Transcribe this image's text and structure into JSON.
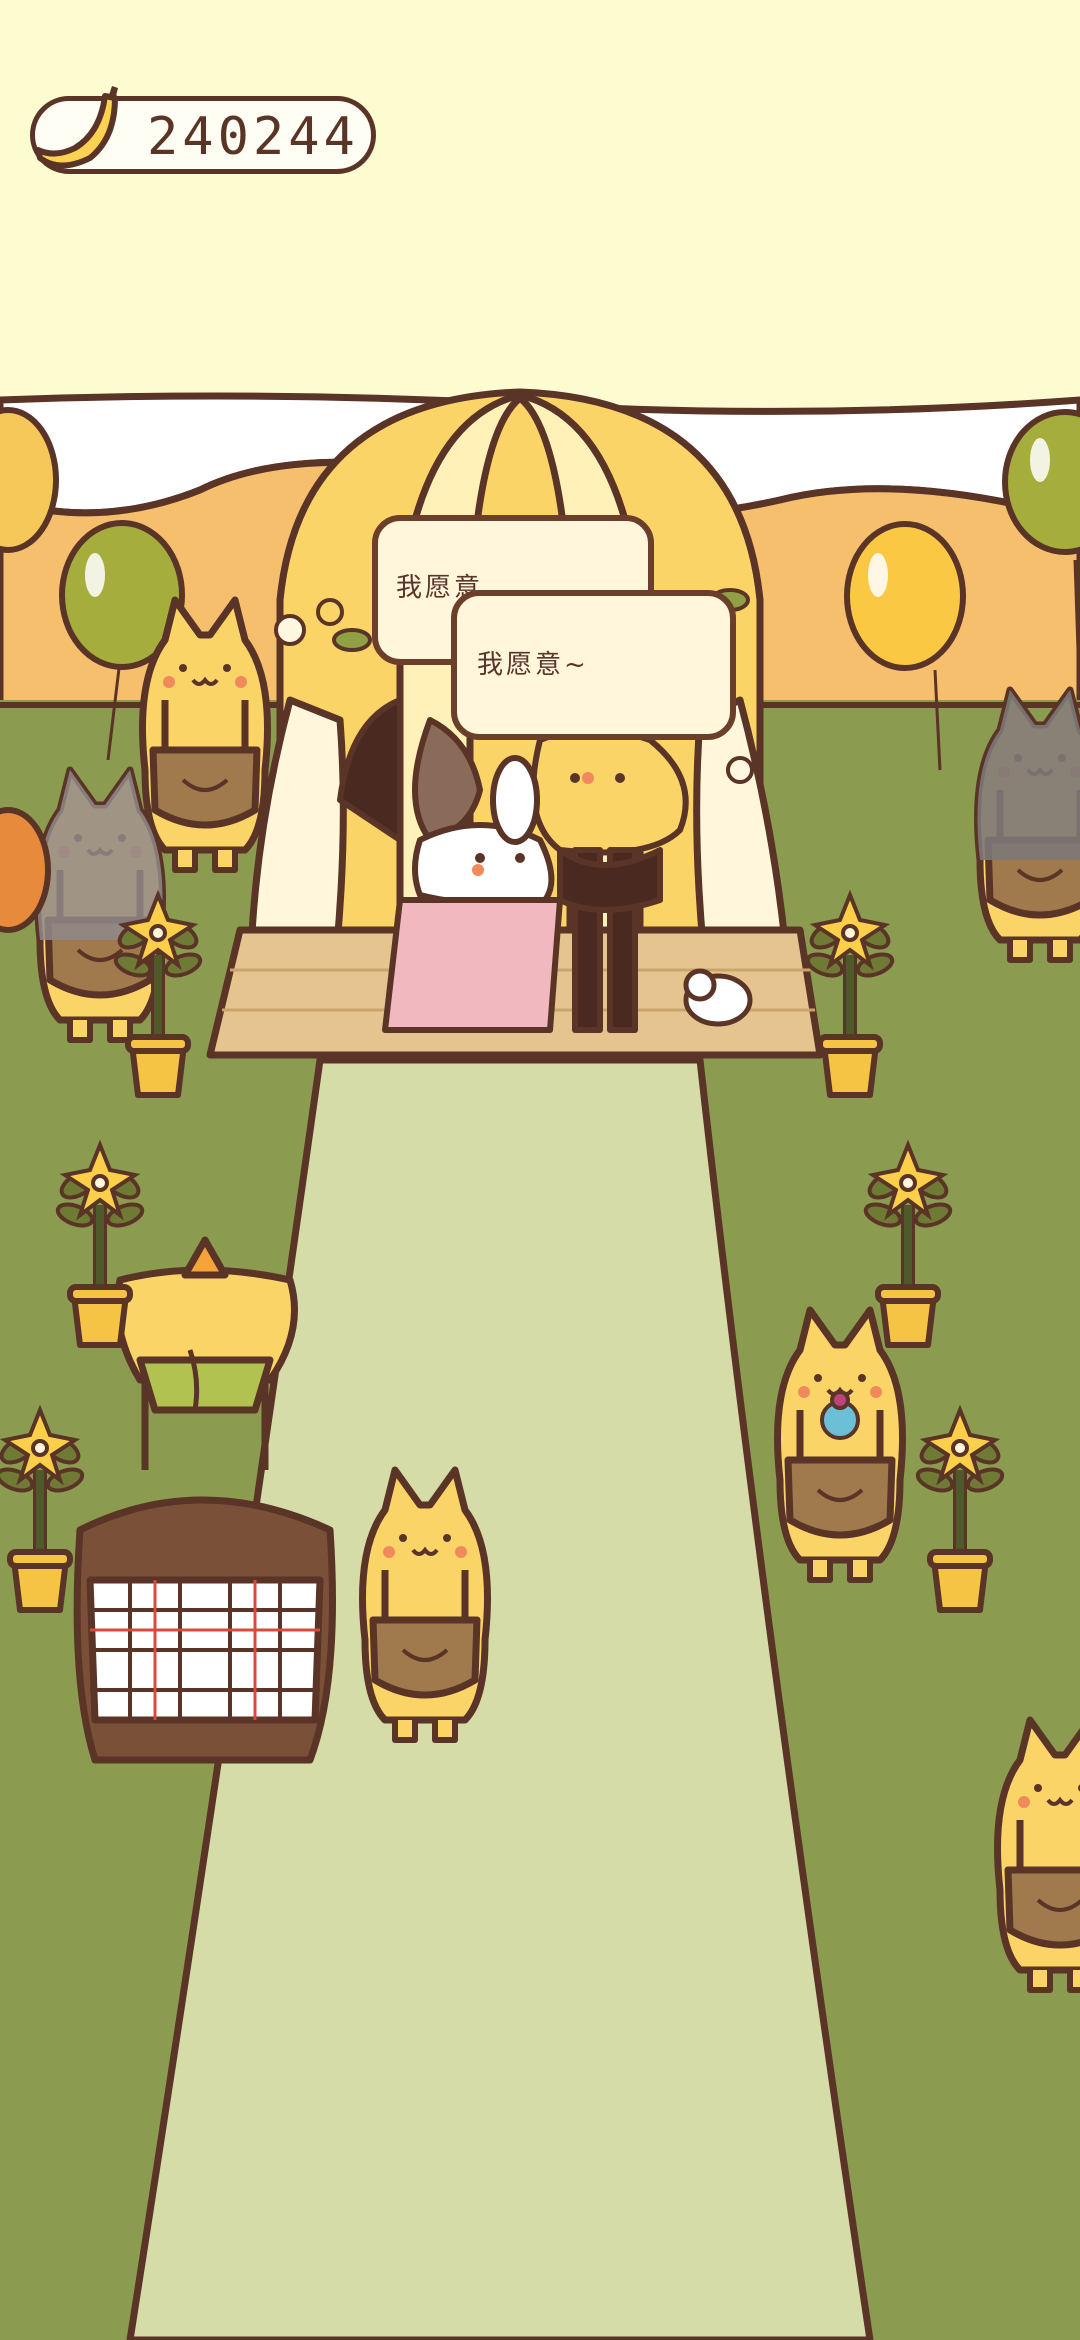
{
  "hud": {
    "banana_count": "240244",
    "currency_icon": "banana-icon"
  },
  "dialogue": [
    {
      "speaker": "groom",
      "text": "我愿意"
    },
    {
      "speaker": "bride",
      "text": "我愿意~"
    }
  ],
  "colors": {
    "sky": "#fdfbd0",
    "grass": "#8b9b4f",
    "aisle": "#d6dca7",
    "outline": "#5a3426",
    "orange_hill": "#f6bf6d",
    "yellow_cat": "#fbd468",
    "apron": "#a07a4c"
  }
}
